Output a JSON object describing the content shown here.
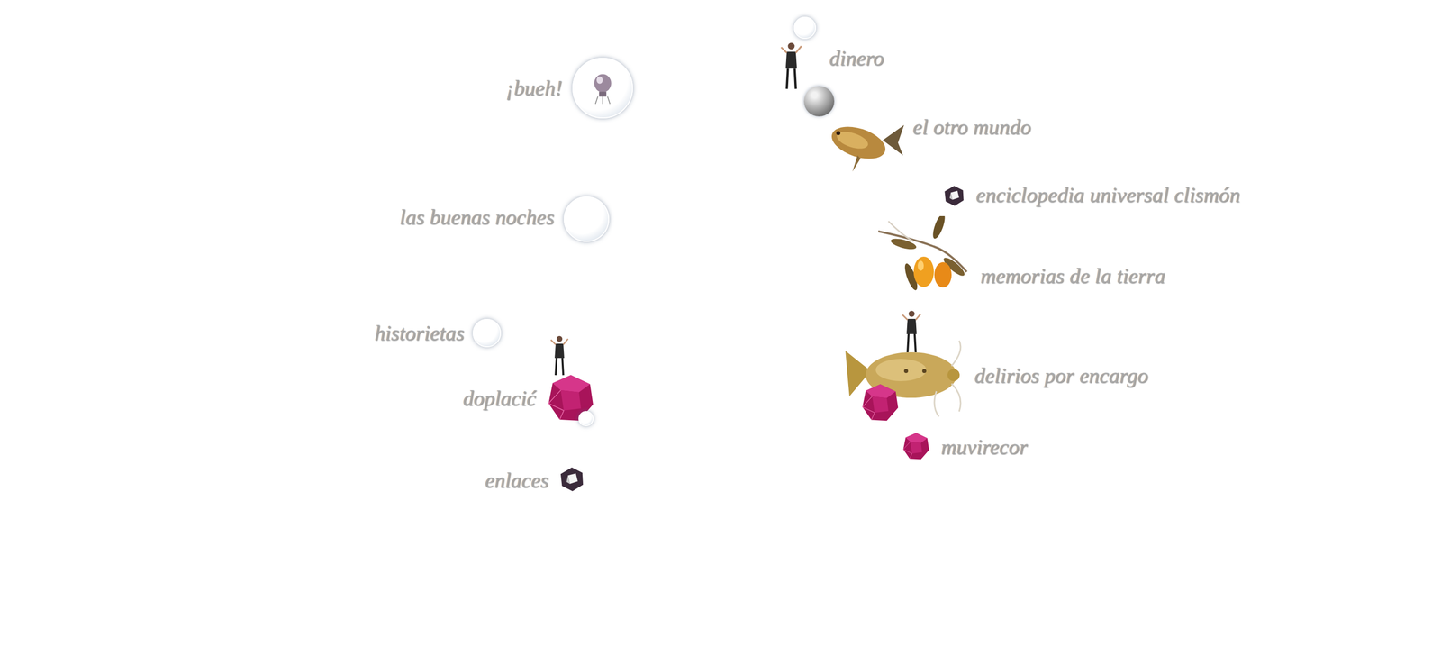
{
  "menu": {
    "items": [
      {
        "label": "dinero",
        "kind": "figure-ball"
      },
      {
        "label": "¡bueh!",
        "kind": "bulb-bubble"
      },
      {
        "label": "el otro mundo",
        "kind": "fish"
      },
      {
        "label": "enciclopedia universal clismón",
        "kind": "dark-gem"
      },
      {
        "label": "las buenas noches",
        "kind": "bubble"
      },
      {
        "label": "memorias de la tierra",
        "kind": "fruit"
      },
      {
        "label": "historietas",
        "kind": "bubble"
      },
      {
        "label": "doplacić",
        "kind": "gem-figure"
      },
      {
        "label": "delirios por encargo",
        "kind": "catfish"
      },
      {
        "label": "muvirecor",
        "kind": "magenta-gem"
      },
      {
        "label": "enlaces",
        "kind": "dark-gem"
      }
    ]
  }
}
